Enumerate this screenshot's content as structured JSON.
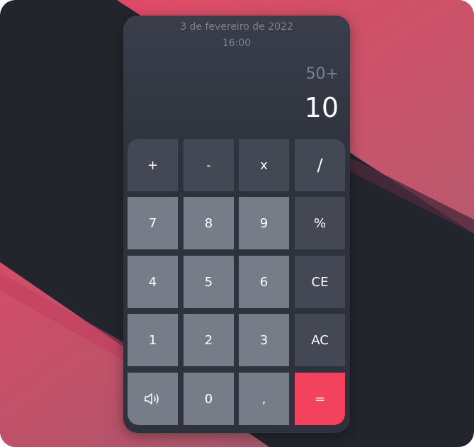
{
  "header": {
    "date": "3 de fevereiro de 2022",
    "time": "16:00"
  },
  "display": {
    "expression": "50+",
    "result": "10"
  },
  "keys": {
    "plus": "+",
    "minus": "-",
    "times": "x",
    "divide": "/",
    "seven": "7",
    "eight": "8",
    "nine": "9",
    "percent": "%",
    "four": "4",
    "five": "5",
    "six": "6",
    "ce": "CE",
    "one": "1",
    "two": "2",
    "three": "3",
    "ac": "AC",
    "sound_icon": "speaker-icon",
    "zero": "0",
    "comma": ",",
    "equals": "="
  },
  "colors": {
    "background_dark": "#23252d",
    "accent_pink": "#d24a63",
    "operator_key": "#444855",
    "number_key": "#777c89",
    "equals_key": "#f2425c"
  }
}
